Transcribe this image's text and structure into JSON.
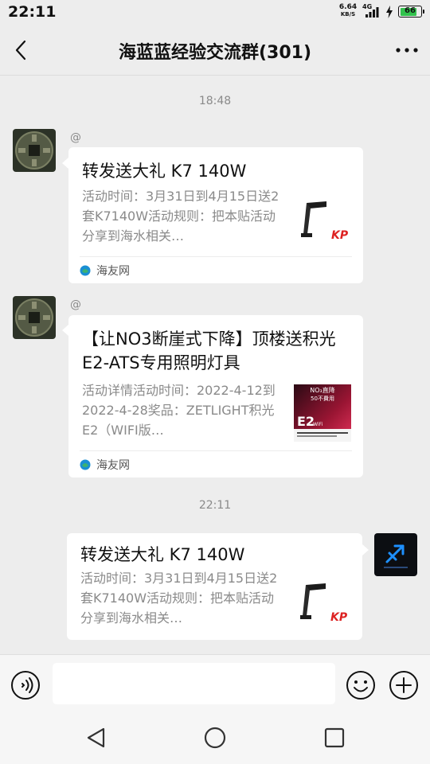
{
  "status_bar": {
    "time": "22:11",
    "net_speed_value": "6.64",
    "net_speed_unit": "KB/S",
    "network_type": "4G",
    "battery_level": "66"
  },
  "header": {
    "title": "海蓝蓝经验交流群(301)"
  },
  "messages": [
    {
      "timestamp": "18:48",
      "sender_name": "@",
      "card_title": "转发送大礼 K7 140W",
      "card_desc": "活动时间：3月31日到4月15日送2套K7140W活动规则：把本贴活动分享到海水相关…",
      "source": "海友网",
      "thumb_brand": "KP",
      "side": "left"
    },
    {
      "sender_name": "@",
      "card_title": "【让NO3断崖式下降】顶楼送积光E2-ATS专用照明灯具",
      "card_desc": "活动详情活动时间：2022-4-12到2022-4-28奖品：ZETLIGHT积光E2（WIFI版…",
      "source": "海友网",
      "thumb_line1": "NO₃直降",
      "thumb_line2": "50不費用",
      "thumb_brand": "E2",
      "thumb_sub": "WiFi",
      "side": "left"
    },
    {
      "timestamp": "22:11",
      "card_title": "转发送大礼 K7 140W",
      "card_desc": "活动时间：3月31日到4月15日送2套K7140W活动规则：把本贴活动分享到海水相关…",
      "thumb_brand": "KP",
      "side": "right"
    }
  ],
  "input": {
    "placeholder": ""
  },
  "icons": {
    "back": "back-arrow-icon",
    "more": "more-dots-icon",
    "voice": "voice-icon",
    "emoji": "emoji-icon",
    "plus": "plus-icon",
    "source": "source-icon"
  },
  "colors": {
    "background": "#ededed",
    "card": "#ffffff",
    "muted_text": "#8a8a8a",
    "battery_fill": "#32c24d"
  }
}
